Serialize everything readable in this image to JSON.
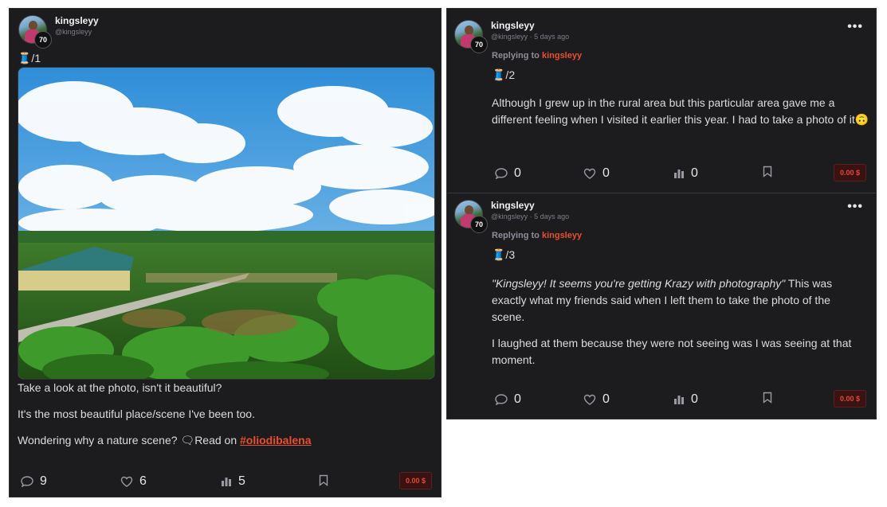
{
  "left_post": {
    "username": "kingsleyy",
    "handle": "@kingsleyy",
    "level": "70",
    "thread_index": "🧵/1",
    "photo_alt": "Rural landscape with blue sky, clouds and a green-roofed building",
    "paragraphs": [
      "Take a look at the photo, isn't it beautiful?",
      "It's the most beautiful place/scene I've been too."
    ],
    "last_paragraph_prefix": "Wondering why a nature scene? 🗨Read on ",
    "hashtag": "#oliodibalena",
    "stats": {
      "comments": "9",
      "likes": "6",
      "views": "5"
    },
    "payout": "0.00 $"
  },
  "right_posts": [
    {
      "username": "kingsleyy",
      "handle_time": "@kingsleyy · 5 days ago",
      "level": "70",
      "replying_prefix": "Replying to ",
      "replying_user": "kingsleyy",
      "thread_index": "🧵/2",
      "paragraph": "Although I grew up in the rural area but this particular area gave me a different feeling when I visited it earlier this year. I had to take a photo of it🙃",
      "stats": {
        "comments": "0",
        "likes": "0",
        "views": "0"
      },
      "payout": "0.00 $",
      "menu": "•••"
    },
    {
      "username": "kingsleyy",
      "handle_time": "@kingsleyy · 5 days ago",
      "level": "70",
      "replying_prefix": "Replying to ",
      "replying_user": "kingsleyy",
      "thread_index": "🧵/3",
      "quote": "\"Kingsleyy! It seems you're getting Krazy with photography\"",
      "quote_rest": " This was exactly what my friends said when I left them to take the photo of the scene.",
      "paragraph2": "I laughed at them because they were not seeing was I was seeing at that moment.",
      "stats": {
        "comments": "0",
        "likes": "0",
        "views": "0"
      },
      "payout": "0.00 $",
      "menu": "•••"
    }
  ],
  "colors": {
    "accent": "#e84f2d",
    "card_bg": "#1c1c1f",
    "payout_bg": "#3b1212"
  },
  "icons": [
    "comment-icon",
    "heart-icon",
    "bar-chart-icon",
    "bookmark-icon",
    "more-icon"
  ]
}
